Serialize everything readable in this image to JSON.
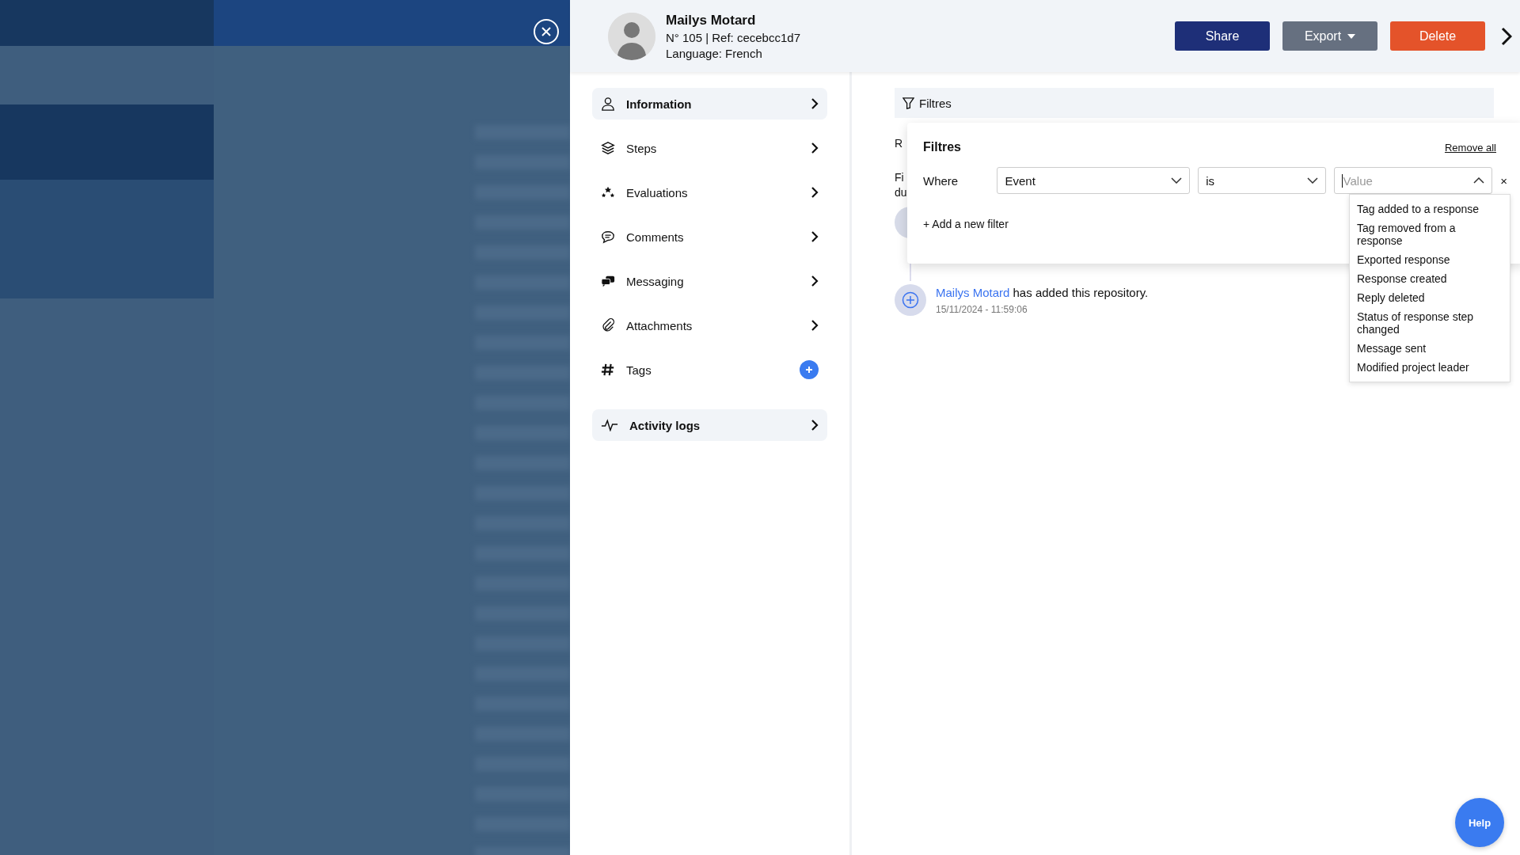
{
  "profile": {
    "name": "Mailys Motard",
    "reference": "N° 105 | Ref: cecebcc1d7",
    "language": "Language: French"
  },
  "actions": [
    {
      "label": "Share",
      "kind": "primary"
    },
    {
      "label": "Export",
      "kind": "dropdown"
    },
    {
      "label": "Delete",
      "kind": "danger"
    }
  ],
  "nav": [
    {
      "label": "Information",
      "kind": "link",
      "selected": true
    },
    {
      "label": "Steps",
      "kind": "link",
      "selected": false
    },
    {
      "label": "Evaluations",
      "kind": "link",
      "selected": false
    },
    {
      "label": "Comments",
      "kind": "link",
      "selected": false
    },
    {
      "label": "Messaging",
      "kind": "link",
      "selected": false
    },
    {
      "label": "Attachments",
      "kind": "link",
      "selected": false
    },
    {
      "label": "Tags",
      "kind": "add",
      "selected": false
    },
    {
      "label": "Activity logs",
      "kind": "link",
      "selected": true
    }
  ],
  "filter_bar": {
    "label": "Filtres"
  },
  "underlying_text": [
    "R",
    "Fi",
    "du"
  ],
  "filter_popup": {
    "title": "Filtres",
    "remove_all": "Remove all",
    "where": "Where",
    "field": "Event",
    "operator": "is",
    "value_placeholder": "Value",
    "expanded": true,
    "remove_filter": "×",
    "add_filter": "+ Add a new filter",
    "options": [
      "Tag added to a response",
      "Tag removed from a response",
      "Exported response",
      "Response created",
      "Reply deleted",
      "Status of response step changed",
      "Message sent",
      "Modified project leader"
    ]
  },
  "log": [
    {
      "author": "Mailys Motard",
      "action": "has added this repository.",
      "time": "15/11/2024 - 11:59:06"
    }
  ],
  "help": "Help"
}
